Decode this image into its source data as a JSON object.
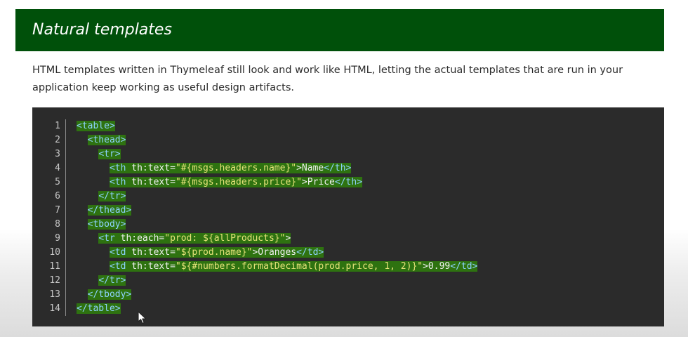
{
  "header": {
    "title": "Natural templates"
  },
  "description": "HTML templates written in Thymeleaf still look and work like HTML, letting the actual templates that are run in your application keep working as useful design artifacts.",
  "code": {
    "line_numbers": [
      "1",
      "2",
      "3",
      "4",
      "5",
      "6",
      "7",
      "8",
      "9",
      "10",
      "11",
      "12",
      "13",
      "14"
    ],
    "lines": [
      [
        {
          "t": "tag",
          "v": "<table>"
        }
      ],
      [
        {
          "t": "text",
          "v": "  "
        },
        {
          "t": "tag",
          "v": "<thead>"
        }
      ],
      [
        {
          "t": "text",
          "v": "    "
        },
        {
          "t": "tag",
          "v": "<tr>"
        }
      ],
      [
        {
          "t": "text",
          "v": "      "
        },
        {
          "t": "tag",
          "v": "<th"
        },
        {
          "t": "attr",
          "v": " th:text="
        },
        {
          "t": "str",
          "v": "\"#{msgs.headers.name}\""
        },
        {
          "t": "text",
          "v": ">Name"
        },
        {
          "t": "tag",
          "v": "</th>"
        }
      ],
      [
        {
          "t": "text",
          "v": "      "
        },
        {
          "t": "tag",
          "v": "<th"
        },
        {
          "t": "attr",
          "v": " th:text="
        },
        {
          "t": "str",
          "v": "\"#{msgs.headers.price}\""
        },
        {
          "t": "text",
          "v": ">Price"
        },
        {
          "t": "tag",
          "v": "</th>"
        }
      ],
      [
        {
          "t": "text",
          "v": "    "
        },
        {
          "t": "tag",
          "v": "</tr>"
        }
      ],
      [
        {
          "t": "text",
          "v": "  "
        },
        {
          "t": "tag",
          "v": "</thead>"
        }
      ],
      [
        {
          "t": "text",
          "v": "  "
        },
        {
          "t": "tag",
          "v": "<tbody>"
        }
      ],
      [
        {
          "t": "text",
          "v": "    "
        },
        {
          "t": "tag",
          "v": "<tr"
        },
        {
          "t": "attr",
          "v": " th:each="
        },
        {
          "t": "str",
          "v": "\"prod: ${allProducts}\""
        },
        {
          "t": "text",
          "v": ">"
        }
      ],
      [
        {
          "t": "text",
          "v": "      "
        },
        {
          "t": "tag",
          "v": "<td"
        },
        {
          "t": "attr",
          "v": " th:text="
        },
        {
          "t": "str",
          "v": "\"${prod.name}\""
        },
        {
          "t": "text",
          "v": ">Oranges"
        },
        {
          "t": "tag",
          "v": "</td>"
        }
      ],
      [
        {
          "t": "text",
          "v": "      "
        },
        {
          "t": "tag",
          "v": "<td"
        },
        {
          "t": "attr",
          "v": " th:text="
        },
        {
          "t": "str",
          "v": "\"${#numbers.formatDecimal(prod.price, 1, 2)}\""
        },
        {
          "t": "text",
          "v": ">0.99"
        },
        {
          "t": "tag",
          "v": "</td>"
        }
      ],
      [
        {
          "t": "text",
          "v": "    "
        },
        {
          "t": "tag",
          "v": "</tr>"
        }
      ],
      [
        {
          "t": "text",
          "v": "  "
        },
        {
          "t": "tag",
          "v": "</tbody>"
        }
      ],
      [
        {
          "t": "tag",
          "v": "</table>"
        }
      ]
    ]
  },
  "colors": {
    "header_bg": "#00500a",
    "code_bg": "#2b2b2b",
    "selection": "#2e7210",
    "tag": "#8fd2ff",
    "string": "#e6e27a"
  },
  "icons": {
    "cursor": "mouse-pointer-icon"
  }
}
